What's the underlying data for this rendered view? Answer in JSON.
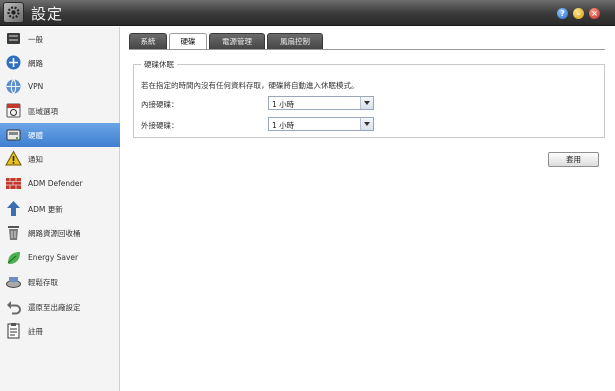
{
  "window": {
    "title": "設定"
  },
  "titlebar_buttons": [
    {
      "icon": "help-icon",
      "glyph": "?"
    },
    {
      "icon": "minimize-icon",
      "glyph": "–"
    },
    {
      "icon": "close-icon",
      "glyph": "×"
    }
  ],
  "sidebar": {
    "items": [
      {
        "label": "一般",
        "icon": "general-icon",
        "active": false
      },
      {
        "label": "網路",
        "icon": "network-icon",
        "active": false
      },
      {
        "label": "VPN",
        "icon": "vpn-icon",
        "active": false
      },
      {
        "label": "區域選項",
        "icon": "regional-options-icon",
        "active": false
      },
      {
        "label": "硬體",
        "icon": "hardware-icon",
        "active": true
      },
      {
        "label": "通知",
        "icon": "notification-icon",
        "active": false
      },
      {
        "label": "ADM Defender",
        "icon": "adm-defender-icon",
        "active": false
      },
      {
        "label": "ADM 更新",
        "icon": "adm-update-icon",
        "active": false
      },
      {
        "label": "網路資源回收桶",
        "icon": "recycle-bin-icon",
        "active": false
      },
      {
        "label": "Energy Saver",
        "icon": "energy-saver-icon",
        "active": false
      },
      {
        "label": "輕鬆存取",
        "icon": "easy-access-icon",
        "active": false
      },
      {
        "label": "還原至出廠設定",
        "icon": "factory-reset-icon",
        "active": false
      },
      {
        "label": "註冊",
        "icon": "registration-icon",
        "active": false
      }
    ]
  },
  "tabs": [
    {
      "label": "系統",
      "active": false
    },
    {
      "label": "硬碟",
      "active": true
    },
    {
      "label": "電源管理",
      "active": false
    },
    {
      "label": "風扇控制",
      "active": false
    }
  ],
  "disk_hibernation": {
    "legend": "硬碟休眠",
    "description": "若在指定的時間內沒有任何資料存取，硬碟將自動進入休眠模式。",
    "internal_label": "內接硬碟：",
    "internal_value": "1 小時",
    "external_label": "外接硬碟：",
    "external_value": "1 小時"
  },
  "apply_button": "套用",
  "colors": {
    "active_item": "#4a8ad8",
    "titlebar": "#3a3a3a"
  }
}
